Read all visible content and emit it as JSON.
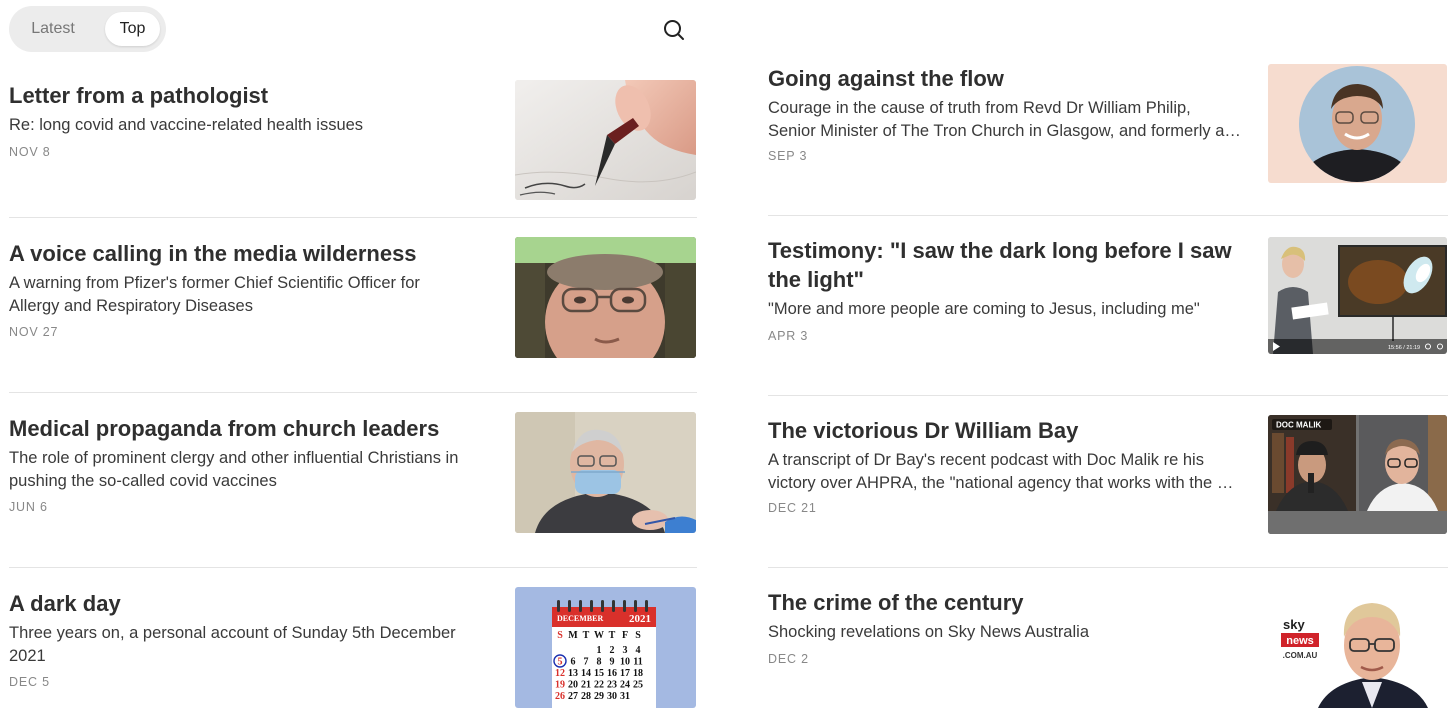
{
  "tabs": {
    "latest": "Latest",
    "top": "Top",
    "active": "Top"
  },
  "posts_left": [
    {
      "title": "Letter from a pathologist",
      "subtitle": "Re: long covid and vaccine-related health issues",
      "date": "NOV 8",
      "thumb": "pen-writing"
    },
    {
      "title": "A voice calling in the media wilderness",
      "subtitle_line1": "A warning from Pfizer's former Chief Scientific Officer for",
      "subtitle_line2": "Allergy and Respiratory Diseases",
      "date": "NOV 27",
      "thumb": "man-portrait-glasses"
    },
    {
      "title": "Medical propaganda from church leaders",
      "subtitle_line1": "The role of prominent clergy and other influential Christians in",
      "subtitle_line2": "pushing the so-called covid vaccines",
      "date": "JUN 6",
      "thumb": "man-receiving-injection"
    },
    {
      "title": "A dark day",
      "subtitle_line1": "Three years on, a personal account of Sunday 5th December",
      "subtitle_line2": "2021",
      "date": "DEC 5",
      "thumb": "calendar",
      "calendar": {
        "month": "DECEMBER",
        "year": "2021",
        "weekdays": [
          "S",
          "M",
          "T",
          "W",
          "T",
          "F",
          "S"
        ],
        "rows": [
          [
            "",
            "",
            "",
            "1",
            "2",
            "3",
            "4"
          ],
          [
            "5",
            "6",
            "7",
            "8",
            "9",
            "10",
            "11"
          ],
          [
            "12",
            "13",
            "14",
            "15",
            "16",
            "17",
            "18"
          ],
          [
            "19",
            "20",
            "21",
            "22",
            "23",
            "24",
            "25"
          ],
          [
            "26",
            "27",
            "28",
            "29",
            "30",
            "31",
            ""
          ]
        ]
      }
    }
  ],
  "posts_right": [
    {
      "title": "Going against the flow",
      "subtitle_line1": "Courage in the cause of truth from Revd Dr William Philip,",
      "subtitle_line2": "Senior Minister of The Tron Church in Glasgow, and formerly a consultant cardiologist",
      "date": "SEP 3",
      "thumb": "circular-portrait"
    },
    {
      "title_line1": "Testimony: \"I saw the dark long before I saw",
      "title_line2": "the light\"",
      "subtitle": "\"More and more people are coming to Jesus, including me\"",
      "date": "APR 3",
      "thumb": "video-still",
      "video_time": "15:56 / 21:19"
    },
    {
      "title": "The victorious Dr William Bay",
      "subtitle_line1": "A transcript of Dr Bay's recent podcast with Doc Malik re his",
      "subtitle_line2": "victory over AHPRA, the \"national agency that works with the national boards\"",
      "date": "DEC 21",
      "thumb": "podcast-still",
      "podcast_label": "DOC MALIK"
    },
    {
      "title": "The crime of the century",
      "subtitle": "Shocking revelations on Sky News Australia",
      "date": "DEC 2",
      "thumb": "sky-news",
      "sky": {
        "line1": "sky",
        "line2": "news",
        "line3": ".COM.AU"
      }
    }
  ],
  "colors": {
    "calendar_red": "#d9302b",
    "calendar_bg": "#a4b9e2",
    "green_band": "#a7d48f",
    "sky_red": "#d0232a",
    "portrait_bg": "#f6dccf"
  }
}
